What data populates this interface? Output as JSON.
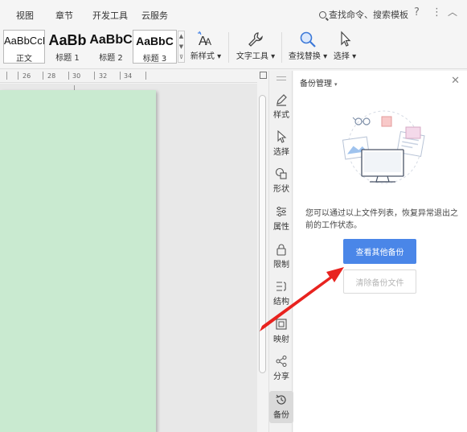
{
  "menu": {
    "items": [
      "视图",
      "章节",
      "开发工具",
      "云服务"
    ],
    "search_text": "查找命令、搜索模板",
    "help_icon": "question-icon",
    "more_icon": "more-icon",
    "collapse_icon": "chevron-up-icon"
  },
  "ribbon": {
    "styles": [
      {
        "preview": "AaBbCcI",
        "label": "正文"
      },
      {
        "preview": "AaBb",
        "label": "标题 1"
      },
      {
        "preview": "AaBbC",
        "label": "标题 2"
      },
      {
        "preview": "AaBbC",
        "label": "标题 3"
      }
    ],
    "new_style": "新样式",
    "text_tool": "文字工具",
    "find_replace": "查找替换",
    "select": "选择"
  },
  "ruler": {
    "ticks": [
      "26",
      "28",
      "30",
      "32",
      "34"
    ]
  },
  "tool_strip": {
    "items": [
      {
        "label": "样式",
        "icon": "pen-icon"
      },
      {
        "label": "选择",
        "icon": "cursor-icon"
      },
      {
        "label": "形状",
        "icon": "shape-icon"
      },
      {
        "label": "属性",
        "icon": "sliders-icon"
      },
      {
        "label": "限制",
        "icon": "lock-icon"
      },
      {
        "label": "结构",
        "icon": "structure-icon"
      },
      {
        "label": "映射",
        "icon": "map-icon"
      },
      {
        "label": "分享",
        "icon": "share-icon"
      },
      {
        "label": "备份",
        "icon": "history-icon"
      }
    ],
    "active": "备份"
  },
  "backup_panel": {
    "title": "备份管理",
    "description": "您可以通过以上文件列表，恢复异常退出之前的工作状态。",
    "primary_button": "查看其他备份",
    "secondary_button": "清除备份文件"
  },
  "colors": {
    "page_green": "#c9ead0",
    "primary_blue": "#4a86e8",
    "annotation_red": "#e8231f"
  }
}
